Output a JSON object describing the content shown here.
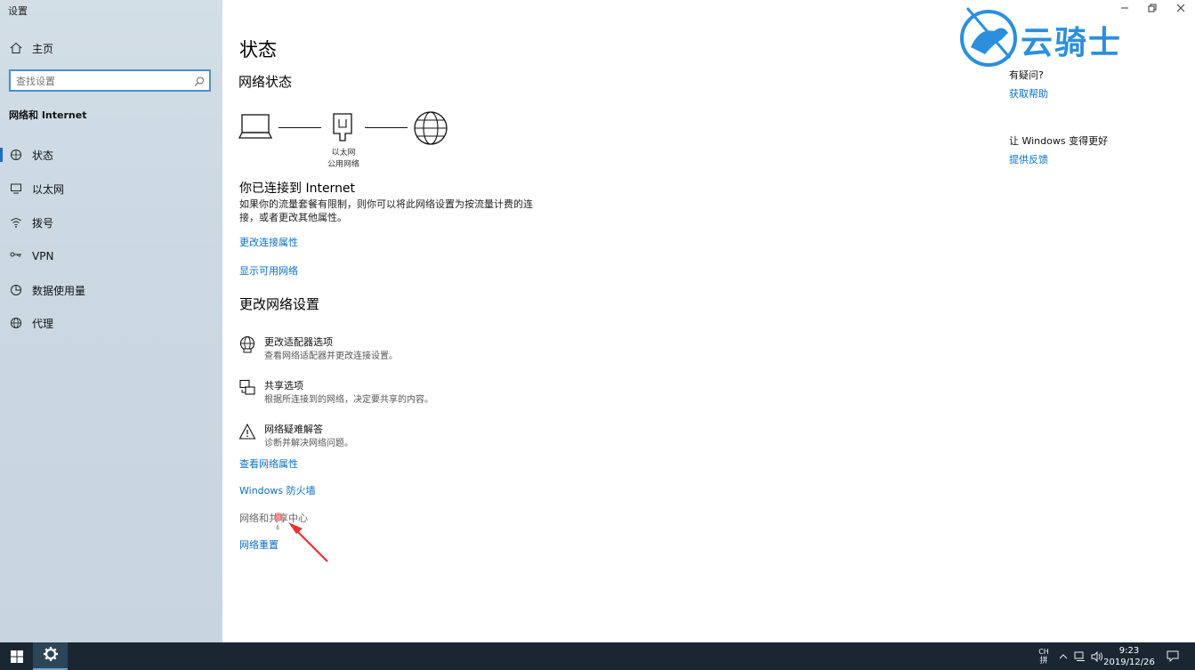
{
  "window": {
    "title": "设置"
  },
  "sidebar": {
    "home_label": "主页",
    "search_placeholder": "查找设置",
    "section_title": "网络和 Internet",
    "items": [
      {
        "label": "状态",
        "icon": "home-network-icon",
        "selected": true
      },
      {
        "label": "以太网",
        "icon": "monitor-icon"
      },
      {
        "label": "拨号",
        "icon": "wifi-icon"
      },
      {
        "label": "VPN",
        "icon": "vpn-icon"
      },
      {
        "label": "数据使用量",
        "icon": "data-usage-icon"
      },
      {
        "label": "代理",
        "icon": "globe-icon"
      }
    ]
  },
  "main": {
    "page_title": "状态",
    "network_status_heading": "网络状态",
    "diagram": {
      "adapter_label": "以太网",
      "network_type": "公用网络"
    },
    "connected_heading": "你已连接到 Internet",
    "connected_desc": "如果你的流量套餐有限制，则你可以将此网络设置为按流量计费的连接，或者更改其他属性。",
    "links_top": [
      "更改连接属性",
      "显示可用网络"
    ],
    "change_settings_heading": "更改网络设置",
    "settings": [
      {
        "title": "更改适配器选项",
        "desc": "查看网络适配器并更改连接设置。",
        "icon": "adapter-globe-icon"
      },
      {
        "title": "共享选项",
        "desc": "根据所连接到的网络，决定要共享的内容。",
        "icon": "sharing-icon"
      },
      {
        "title": "网络疑难解答",
        "desc": "诊断并解决网络问题。",
        "icon": "warning-icon"
      }
    ],
    "links_bottom": [
      "查看网络属性",
      "Windows 防火墙",
      "网络和共享中心",
      "网络重置"
    ]
  },
  "right_panel": {
    "question": "有疑问?",
    "help_link": "获取帮助",
    "feedback_heading": "让 Windows 变得更好",
    "feedback_link": "提供反馈"
  },
  "watermark": {
    "text": "云骑士"
  },
  "taskbar": {
    "ime_top": "CH",
    "ime_bottom": "拼",
    "time": "9:23",
    "date": "2019/12/26"
  },
  "colors": {
    "accent": "#0b6fc7",
    "taskbar": "#1a2733"
  }
}
